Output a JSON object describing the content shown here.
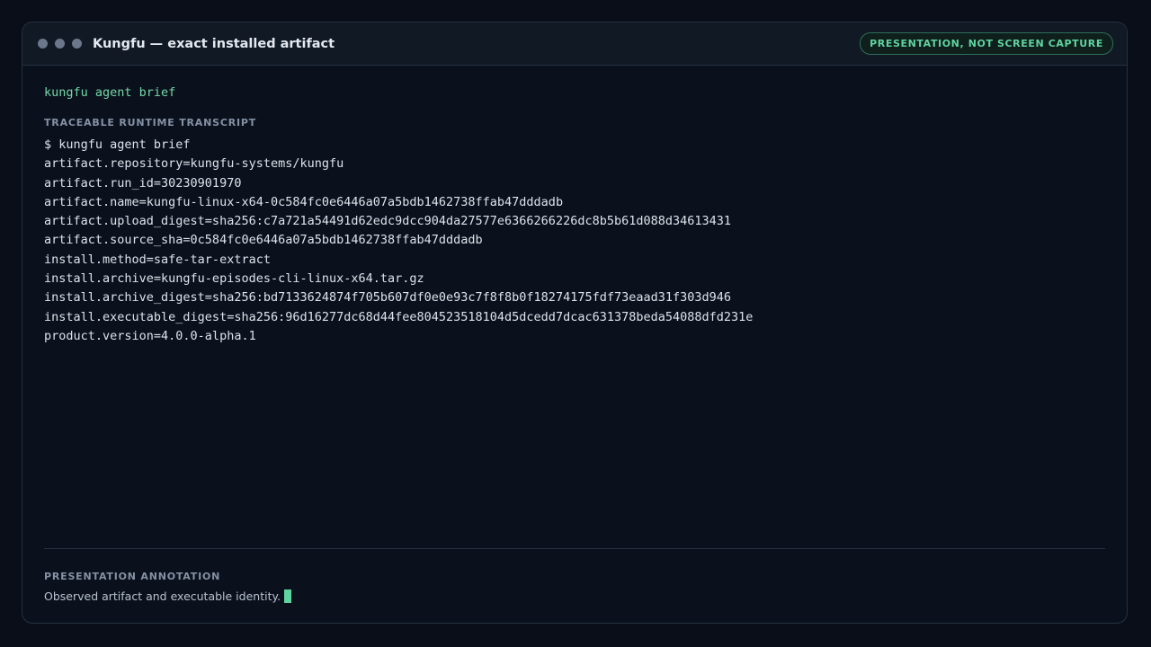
{
  "window": {
    "title": "Kungfu — exact installed artifact",
    "badge": "PRESENTATION, NOT SCREEN CAPTURE"
  },
  "command": "kungfu agent brief",
  "transcript": {
    "label": "TRACEABLE RUNTIME TRANSCRIPT",
    "lines": [
      "$ kungfu agent brief",
      "artifact.repository=kungfu-systems/kungfu",
      "artifact.run_id=30230901970",
      "artifact.name=kungfu-linux-x64-0c584fc0e6446a07a5bdb1462738ffab47dddadb",
      "artifact.upload_digest=sha256:c7a721a54491d62edc9dcc904da27577e6366266226dc8b5b61d088d34613431",
      "artifact.source_sha=0c584fc0e6446a07a5bdb1462738ffab47dddadb",
      "install.method=safe-tar-extract",
      "install.archive=kungfu-episodes-cli-linux-x64.tar.gz",
      "install.archive_digest=sha256:bd7133624874f705b607df0e0e93c7f8f8b0f18274175fdf73eaad31f303d946",
      "install.executable_digest=sha256:96d16277dc68d44fee804523518104d5dcedd7dcac631378beda54088dfd231e",
      "product.version=4.0.0-alpha.1"
    ]
  },
  "annotation": {
    "label": "PRESENTATION ANNOTATION",
    "text": "Observed artifact and executable identity."
  },
  "colors": {
    "background": "#090e18",
    "panel": "#0b111c",
    "accent": "#5fd4a0",
    "text": "#dce3ec"
  }
}
